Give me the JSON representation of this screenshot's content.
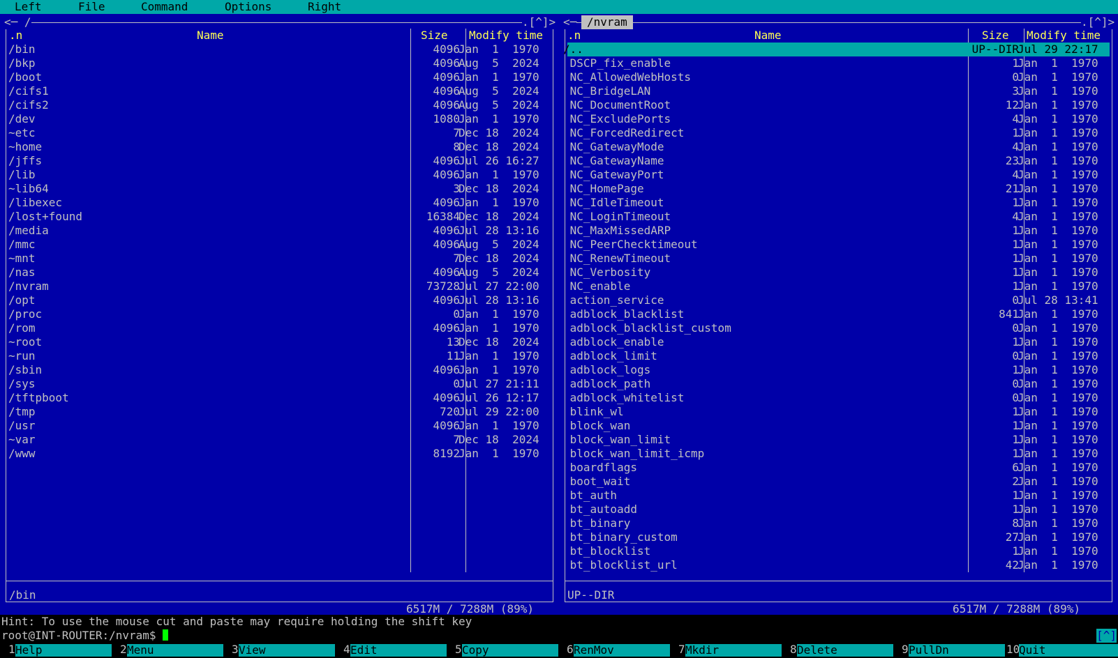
{
  "menubar": {
    "items": [
      "Left",
      "File",
      "Command",
      "Options",
      "Right"
    ]
  },
  "left_panel": {
    "path_left": "<─ /",
    "path_right": ".[^]>",
    "headers": {
      "n": ".n",
      "name": "Name",
      "size": "Size",
      "modify": "Modify time"
    },
    "rows": [
      {
        "name": "/bin",
        "size": "4096",
        "time": "Jan  1  1970"
      },
      {
        "name": "/bkp",
        "size": "4096",
        "time": "Aug  5  2024"
      },
      {
        "name": "/boot",
        "size": "4096",
        "time": "Jan  1  1970"
      },
      {
        "name": "/cifs1",
        "size": "4096",
        "time": "Aug  5  2024"
      },
      {
        "name": "/cifs2",
        "size": "4096",
        "time": "Aug  5  2024"
      },
      {
        "name": "/dev",
        "size": "1080",
        "time": "Jan  1  1970"
      },
      {
        "name": "~etc",
        "size": "7",
        "time": "Dec 18  2024"
      },
      {
        "name": "~home",
        "size": "8",
        "time": "Dec 18  2024"
      },
      {
        "name": "/jffs",
        "size": "4096",
        "time": "Jul 26 16:27"
      },
      {
        "name": "/lib",
        "size": "4096",
        "time": "Jan  1  1970"
      },
      {
        "name": "~lib64",
        "size": "3",
        "time": "Dec 18  2024"
      },
      {
        "name": "/libexec",
        "size": "4096",
        "time": "Jan  1  1970"
      },
      {
        "name": "/lost+found",
        "size": "16384",
        "time": "Dec 18  2024"
      },
      {
        "name": "/media",
        "size": "4096",
        "time": "Jul 28 13:16"
      },
      {
        "name": "/mmc",
        "size": "4096",
        "time": "Aug  5  2024"
      },
      {
        "name": "~mnt",
        "size": "7",
        "time": "Dec 18  2024"
      },
      {
        "name": "/nas",
        "size": "4096",
        "time": "Aug  5  2024"
      },
      {
        "name": "/nvram",
        "size": "73728",
        "time": "Jul 27 22:00"
      },
      {
        "name": "/opt",
        "size": "4096",
        "time": "Jul 28 13:16"
      },
      {
        "name": "/proc",
        "size": "0",
        "time": "Jan  1  1970"
      },
      {
        "name": "/rom",
        "size": "4096",
        "time": "Jan  1  1970"
      },
      {
        "name": "~root",
        "size": "13",
        "time": "Dec 18  2024"
      },
      {
        "name": "~run",
        "size": "11",
        "time": "Jan  1  1970"
      },
      {
        "name": "/sbin",
        "size": "4096",
        "time": "Jan  1  1970"
      },
      {
        "name": "/sys",
        "size": "0",
        "time": "Jul 27 21:11"
      },
      {
        "name": "/tftpboot",
        "size": "4096",
        "time": "Jul 26 12:17"
      },
      {
        "name": "/tmp",
        "size": "720",
        "time": "Jul 29 22:00"
      },
      {
        "name": "/usr",
        "size": "4096",
        "time": "Jan  1  1970"
      },
      {
        "name": "~var",
        "size": "7",
        "time": "Dec 18  2024"
      },
      {
        "name": "/www",
        "size": "8192",
        "time": "Jan  1  1970"
      }
    ],
    "status": "/bin",
    "footer": "6517M / 7288M (89%)"
  },
  "right_panel": {
    "path_left": "<─",
    "path_current": "/nvram",
    "path_right": ".[^]>",
    "headers": {
      "n": ".n",
      "name": "Name",
      "size": "Size",
      "modify": "Modify time"
    },
    "rows": [
      {
        "name": "/..",
        "size": "UP--DIR",
        "time": "Jul 29 22:17",
        "selected": true
      },
      {
        "name": " DSCP_fix_enable",
        "size": "1",
        "time": "Jan  1  1970"
      },
      {
        "name": " NC_AllowedWebHosts",
        "size": "0",
        "time": "Jan  1  1970"
      },
      {
        "name": " NC_BridgeLAN",
        "size": "3",
        "time": "Jan  1  1970"
      },
      {
        "name": " NC_DocumentRoot",
        "size": "12",
        "time": "Jan  1  1970"
      },
      {
        "name": " NC_ExcludePorts",
        "size": "4",
        "time": "Jan  1  1970"
      },
      {
        "name": " NC_ForcedRedirect",
        "size": "1",
        "time": "Jan  1  1970"
      },
      {
        "name": " NC_GatewayMode",
        "size": "4",
        "time": "Jan  1  1970"
      },
      {
        "name": " NC_GatewayName",
        "size": "23",
        "time": "Jan  1  1970"
      },
      {
        "name": " NC_GatewayPort",
        "size": "4",
        "time": "Jan  1  1970"
      },
      {
        "name": " NC_HomePage",
        "size": "21",
        "time": "Jan  1  1970"
      },
      {
        "name": " NC_IdleTimeout",
        "size": "1",
        "time": "Jan  1  1970"
      },
      {
        "name": " NC_LoginTimeout",
        "size": "4",
        "time": "Jan  1  1970"
      },
      {
        "name": " NC_MaxMissedARP",
        "size": "1",
        "time": "Jan  1  1970"
      },
      {
        "name": " NC_PeerChecktimeout",
        "size": "1",
        "time": "Jan  1  1970"
      },
      {
        "name": " NC_RenewTimeout",
        "size": "1",
        "time": "Jan  1  1970"
      },
      {
        "name": " NC_Verbosity",
        "size": "1",
        "time": "Jan  1  1970"
      },
      {
        "name": " NC_enable",
        "size": "1",
        "time": "Jan  1  1970"
      },
      {
        "name": " action_service",
        "size": "0",
        "time": "Jul 28 13:41"
      },
      {
        "name": " adblock_blacklist",
        "size": "841",
        "time": "Jan  1  1970"
      },
      {
        "name": " adblock_blacklist_custom",
        "size": "0",
        "time": "Jan  1  1970"
      },
      {
        "name": " adblock_enable",
        "size": "1",
        "time": "Jan  1  1970"
      },
      {
        "name": " adblock_limit",
        "size": "0",
        "time": "Jan  1  1970"
      },
      {
        "name": " adblock_logs",
        "size": "1",
        "time": "Jan  1  1970"
      },
      {
        "name": " adblock_path",
        "size": "0",
        "time": "Jan  1  1970"
      },
      {
        "name": " adblock_whitelist",
        "size": "0",
        "time": "Jan  1  1970"
      },
      {
        "name": " blink_wl",
        "size": "1",
        "time": "Jan  1  1970"
      },
      {
        "name": " block_wan",
        "size": "1",
        "time": "Jan  1  1970"
      },
      {
        "name": " block_wan_limit",
        "size": "1",
        "time": "Jan  1  1970"
      },
      {
        "name": " block_wan_limit_icmp",
        "size": "1",
        "time": "Jan  1  1970"
      },
      {
        "name": " boardflags",
        "size": "6",
        "time": "Jan  1  1970"
      },
      {
        "name": " boot_wait",
        "size": "2",
        "time": "Jan  1  1970"
      },
      {
        "name": " bt_auth",
        "size": "1",
        "time": "Jan  1  1970"
      },
      {
        "name": " bt_autoadd",
        "size": "1",
        "time": "Jan  1  1970"
      },
      {
        "name": " bt_binary",
        "size": "8",
        "time": "Jan  1  1970"
      },
      {
        "name": " bt_binary_custom",
        "size": "27",
        "time": "Jan  1  1970"
      },
      {
        "name": " bt_blocklist",
        "size": "1",
        "time": "Jan  1  1970"
      },
      {
        "name": " bt_blocklist_url",
        "size": "42",
        "time": "Jan  1  1970"
      }
    ],
    "status": "UP--DIR",
    "footer": "6517M / 7288M (89%)"
  },
  "hint": "Hint: To use the mouse cut and paste may require holding the shift key",
  "command_line": {
    "prompt": "root@INT-ROUTER:/nvram$ ",
    "right_marker": "[^]"
  },
  "function_keys": [
    {
      "num": "1",
      "label": "Help"
    },
    {
      "num": "2",
      "label": "Menu"
    },
    {
      "num": "3",
      "label": "View"
    },
    {
      "num": "4",
      "label": "Edit"
    },
    {
      "num": "5",
      "label": "Copy"
    },
    {
      "num": "6",
      "label": "RenMov"
    },
    {
      "num": "7",
      "label": "Mkdir"
    },
    {
      "num": "8",
      "label": "Delete"
    },
    {
      "num": "9",
      "label": "PullDn"
    },
    {
      "num": "10",
      "label": "Quit"
    }
  ],
  "colors": {
    "panel_bg": "#0000a8",
    "menu_bg": "#00a8a8",
    "header_fg": "#ffff55",
    "text": "#c0c0c0",
    "cursor": "#00ff00"
  }
}
